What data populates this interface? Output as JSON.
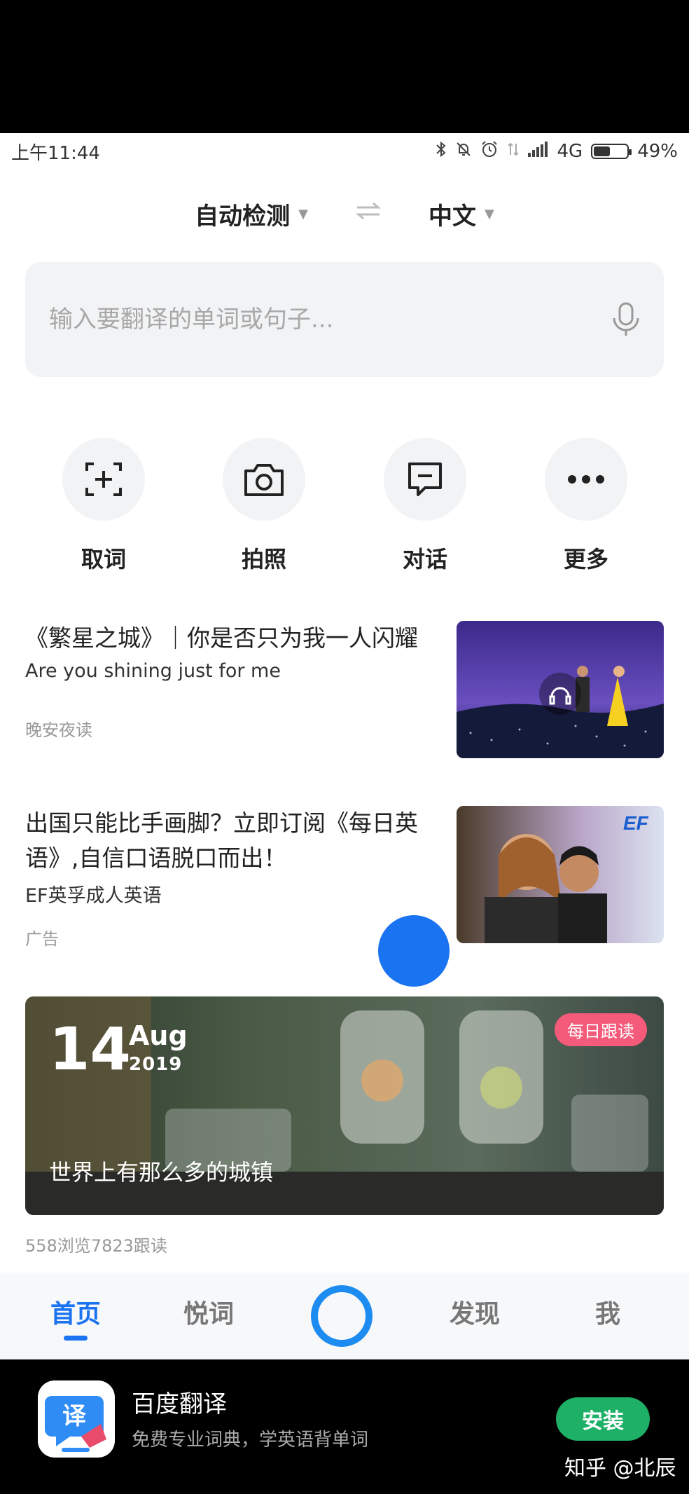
{
  "status_bar": {
    "time": "上午11:44",
    "network": "4G",
    "battery": "49%",
    "battery_level": 0.49
  },
  "language": {
    "source": "自动检测",
    "target": "中文"
  },
  "search": {
    "placeholder": "输入要翻译的单词或句子..."
  },
  "tools": [
    {
      "label": "取词",
      "icon": "scan-word-icon"
    },
    {
      "label": "拍照",
      "icon": "camera-icon"
    },
    {
      "label": "对话",
      "icon": "dialogue-icon"
    },
    {
      "label": "更多",
      "icon": "more-icon"
    }
  ],
  "articles": [
    {
      "title": "《繁星之城》｜你是否只为我一人闪耀",
      "subtitle": "Are you shining just for me",
      "source": "晚安夜读"
    },
    {
      "title": "出国只能比手画脚？立即订阅《每日英语》,自信口语脱口而出！",
      "subtitle": "EF英孚成人英语",
      "source": "广告",
      "thumb_logo": "EF"
    }
  ],
  "daily": {
    "day": "14",
    "month": "Aug",
    "year": "2019",
    "tag": "每日跟读",
    "phrase": "世界上有那么多的城镇",
    "stats": "558浏览7823跟读"
  },
  "tabs": [
    {
      "label": "首页",
      "active": true
    },
    {
      "label": "悦词",
      "active": false
    },
    {
      "label": "发现",
      "active": false
    },
    {
      "label": "我",
      "active": false
    }
  ],
  "promo": {
    "app_name": "百度翻译",
    "description": "免费专业词典，学英语背单词",
    "install_label": "安装",
    "icon_char": "译",
    "watermark": "知乎 @北辰"
  },
  "colors": {
    "accent": "#1a73f0",
    "install_green": "#1db066",
    "tag_pink": "#f45b7a"
  }
}
